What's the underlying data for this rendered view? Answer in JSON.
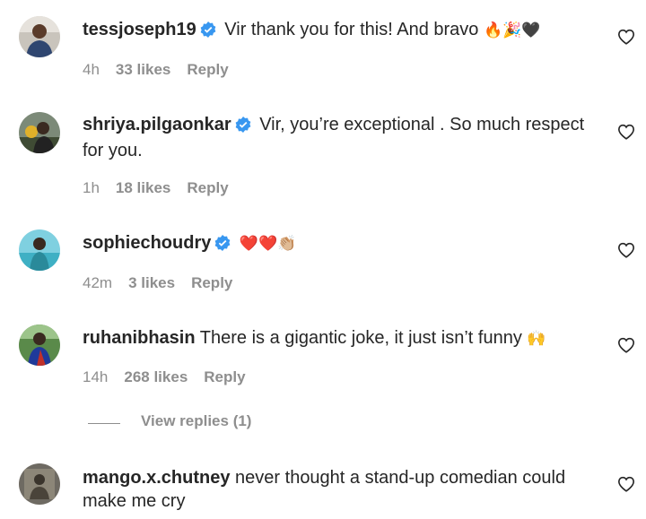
{
  "comments": [
    {
      "username": "tessjoseph19",
      "verified": true,
      "text": "Vir thank you for this! And bravo",
      "emoji": "🔥🎉🖤",
      "time": "4h",
      "likes": "33 likes",
      "reply": "Reply"
    },
    {
      "username": "shriya.pilgaonkar",
      "verified": true,
      "text": "Vir, you’re exceptional . So much respect for you.",
      "emoji": "",
      "time": "1h",
      "likes": "18 likes",
      "reply": "Reply"
    },
    {
      "username": "sophiechoudry",
      "verified": true,
      "text": "",
      "emoji": "❤️❤️👏🏼",
      "time": "42m",
      "likes": "3 likes",
      "reply": "Reply"
    },
    {
      "username": "ruhanibhasin",
      "verified": false,
      "text": "There is a gigantic joke, it just isn’t funny",
      "emoji": "🙌",
      "time": "14h",
      "likes": "268 likes",
      "reply": "Reply"
    },
    {
      "username": "mango.x.chutney",
      "verified": false,
      "text": "never thought a stand-up comedian could make me cry",
      "emoji": ""
    }
  ],
  "view_replies": "View replies (1)",
  "icons": {
    "verified": "verified-badge-icon",
    "like": "heart-outline-icon"
  },
  "colors": {
    "verified": "#3897f0",
    "meta_text": "#8e8e8e",
    "text": "#262626"
  }
}
